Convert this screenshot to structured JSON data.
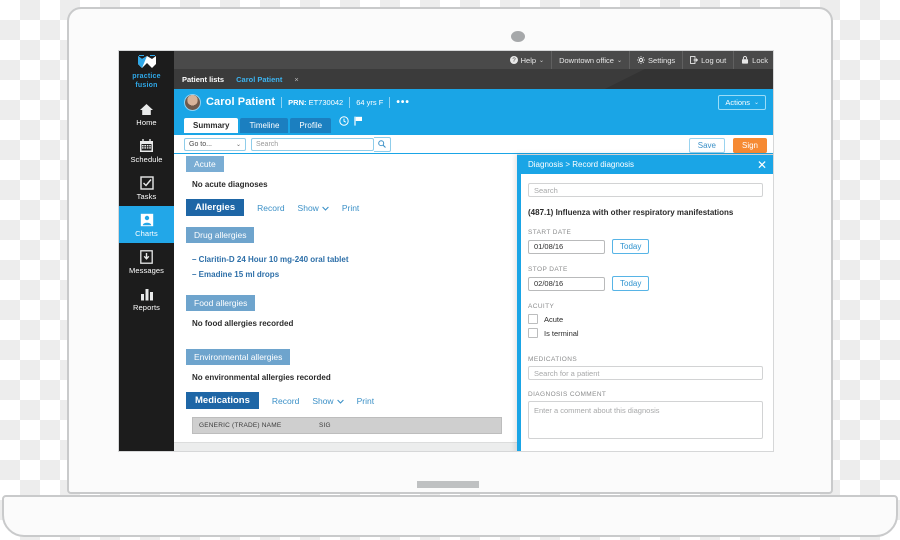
{
  "app": {
    "brand_line1": "practice",
    "brand_line2": "fusion"
  },
  "topbar": {
    "items": [
      {
        "label": "Help",
        "icon": "help-icon",
        "caret": "⌄"
      },
      {
        "label": "Downtown office",
        "icon": "",
        "caret": "⌄"
      },
      {
        "label": "Settings",
        "icon": "gear-icon",
        "caret": ""
      },
      {
        "label": "Log out",
        "icon": "logout-icon",
        "caret": ""
      },
      {
        "label": "Lock",
        "icon": "lock-icon",
        "caret": ""
      }
    ]
  },
  "tabstrip": {
    "patient_lists": "Patient lists",
    "current_tab": "Carol Patient",
    "close": "×"
  },
  "sidebar": {
    "items": [
      {
        "label": "Home",
        "icon": "home-icon",
        "active": false
      },
      {
        "label": "Schedule",
        "icon": "calendar-icon",
        "active": false
      },
      {
        "label": "Tasks",
        "icon": "checkbox-icon",
        "active": false
      },
      {
        "label": "Charts",
        "icon": "person-icon",
        "active": true
      },
      {
        "label": "Messages",
        "icon": "inbox-icon",
        "active": false
      },
      {
        "label": "Reports",
        "icon": "bar-chart-icon",
        "active": false
      }
    ]
  },
  "patient": {
    "name": "Carol Patient",
    "prn_label": "PRN:",
    "prn_value": "ET730042",
    "age_sex": "64 yrs F",
    "more": "•••",
    "actions_label": "Actions",
    "actions_caret": "⌄",
    "tabs": [
      {
        "label": "Summary",
        "active": true
      },
      {
        "label": "Timeline",
        "active": false
      },
      {
        "label": "Profile",
        "active": false
      }
    ]
  },
  "searchrow": {
    "goto_label": "Go to...",
    "goto_caret": "⌄",
    "search_placeholder": "Search",
    "search_value": "",
    "save_label": "Save",
    "sign_label": "Sign"
  },
  "chart": {
    "acute": {
      "title": "Acute",
      "empty_text": "No acute diagnoses"
    },
    "allergies": {
      "title": "Allergies",
      "actions": [
        "Record",
        "Show",
        "Print"
      ],
      "drug": {
        "title": "Drug allergies",
        "items": [
          "– Claritin-D 24 Hour 10 mg-240 oral tablet",
          "– Emadine 15 ml drops"
        ]
      },
      "food": {
        "title": "Food allergies",
        "empty_text": "No food allergies recorded"
      },
      "environmental": {
        "title": "Environmental allergies",
        "empty_text": "No environmental allergies recorded"
      }
    },
    "medications": {
      "title": "Medications",
      "actions": [
        "Record",
        "Show",
        "Print"
      ],
      "columns": [
        "GENERIC (TRADE) NAME",
        "SIG"
      ]
    }
  },
  "panel": {
    "title": "Diagnosis > Record diagnosis",
    "close": "✕",
    "search_placeholder": "Search",
    "diagnosis_text": "(487.1) Influenza with other respiratory manifestations",
    "start_date": {
      "label": "START DATE",
      "value": "01/08/16",
      "today_label": "Today"
    },
    "stop_date": {
      "label": "STOP DATE",
      "value": "02/08/16",
      "today_label": "Today"
    },
    "acuity": {
      "label": "ACUITY",
      "options": [
        {
          "label": "Acute",
          "checked": false
        },
        {
          "label": "Is terminal",
          "checked": false
        }
      ]
    },
    "medications": {
      "label": "MEDICATIONS",
      "placeholder": "Search for a patient",
      "value": ""
    },
    "comment": {
      "label": "DIAGNOSIS COMMENT",
      "placeholder": "Enter a comment about this diagnosis",
      "value": ""
    }
  },
  "colors": {
    "brand_blue": "#1aa5e6",
    "dark_blue": "#1e66a6",
    "orange": "#f68a33",
    "sidebar_dark": "#1c1c1c"
  }
}
